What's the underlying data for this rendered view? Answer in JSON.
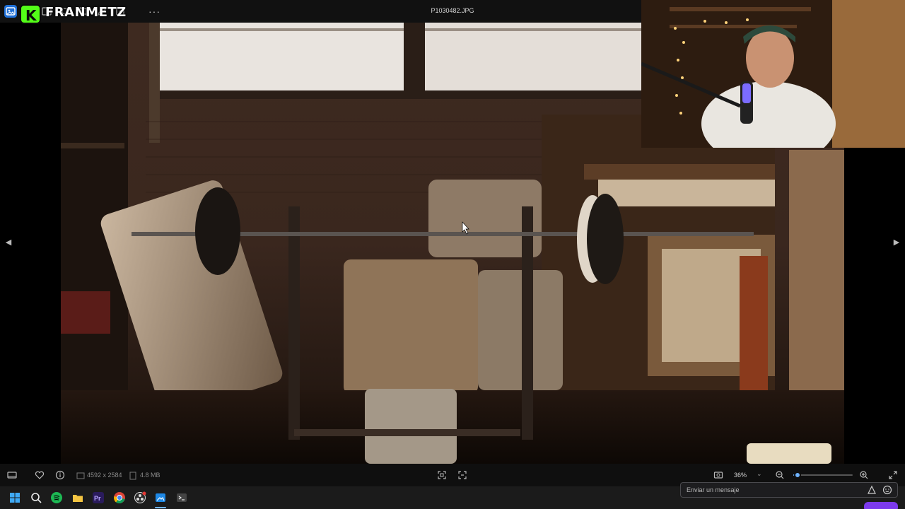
{
  "titlebar": {
    "file_name": "P1030482.JPG",
    "more_label": "···"
  },
  "overlay": {
    "streamer_name": "FRANMETZ",
    "logo_letter": "K",
    "brand_color": "#53fc18"
  },
  "navigation": {
    "prev_label": "◀",
    "next_label": "▶"
  },
  "statusbar": {
    "dimensions": "4592 x 2584",
    "file_size": "4.8 MB",
    "zoom_level": "36%",
    "zoom_slider_value": 0.07
  },
  "chat": {
    "placeholder": "Enviar un mensaje",
    "accent": "#7c3aed"
  },
  "taskbar": {
    "apps": [
      "windows-start-icon",
      "search-icon",
      "spotify-icon",
      "file-explorer-icon",
      "premiere-pro-icon",
      "chrome-icon",
      "obs-icon",
      "photos-app-icon",
      "terminal-icon"
    ]
  }
}
